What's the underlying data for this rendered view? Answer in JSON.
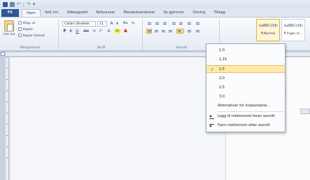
{
  "quick_access": {
    "sep_glyph": "|",
    "undo_glyph": "↶",
    "redo_glyph": "↷",
    "menu_glyph": "▾"
  },
  "tabs": [
    {
      "label": "Fil",
      "state": "file"
    },
    {
      "label": "Hjem",
      "state": "active"
    },
    {
      "label": "Sett inn",
      "state": ""
    },
    {
      "label": "Sideoppsett",
      "state": ""
    },
    {
      "label": "Referanser",
      "state": ""
    },
    {
      "label": "Masseutsendelser",
      "state": ""
    },
    {
      "label": "Se gjennom",
      "state": ""
    },
    {
      "label": "Visning",
      "state": ""
    },
    {
      "label": "Tillegg",
      "state": ""
    }
  ],
  "clipboard": {
    "paste_label": "Lim inn",
    "cut_label": "Klipp ut",
    "copy_label": "Kopier",
    "format_painter_label": "Kopier format",
    "group_label": "Utklippstavle"
  },
  "font": {
    "family": "Calibri (Brødtek",
    "size": "11",
    "grow": "A",
    "shrink": "A",
    "case": "Aa",
    "clear_glyph": "✎",
    "bold": "F",
    "italic": "K",
    "underline": "U",
    "strike": "abc",
    "subscript": "x₂",
    "superscript": "x²",
    "effects": "A",
    "highlight": "ab",
    "color": "A",
    "group_label": "Skrift"
  },
  "paragraph": {
    "group_label": "Avsnitt",
    "line_spacing_active": true
  },
  "styles": [
    {
      "sample": "AaBbCcDc",
      "name": "¶ Normal",
      "active": true
    },
    {
      "sample": "AaBbCcDc",
      "name": "¶ Ingen m...",
      "active": false
    }
  ],
  "document": {
    "partial_text": "ebladet"
  },
  "line_spacing_menu": {
    "check_glyph": "✓",
    "options": [
      {
        "label": "1,0",
        "selected": false
      },
      {
        "label": "1,15",
        "selected": false
      },
      {
        "label": "1,5",
        "selected": true
      },
      {
        "label": "2,0",
        "selected": false
      },
      {
        "label": "2,5",
        "selected": false
      },
      {
        "label": "3,0",
        "selected": false
      }
    ],
    "more_options": "Alternativer for linjeavstand...",
    "add_space_before": "Legg til mellomrom foran avsnitt",
    "remove_space_after": "Fjern mellomrom etter avsnitt"
  }
}
